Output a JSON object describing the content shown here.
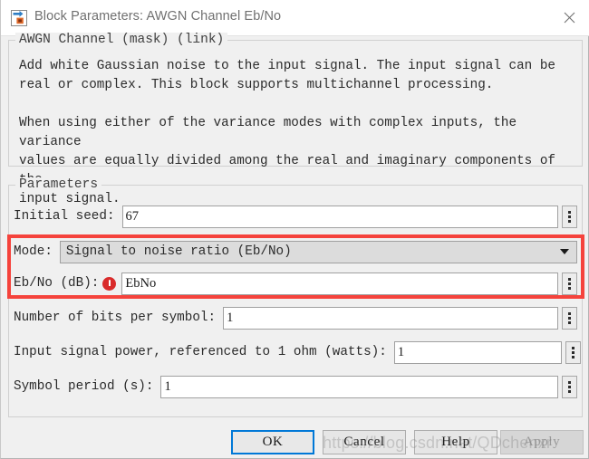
{
  "window": {
    "title": "Block Parameters: AWGN Channel Eb/No",
    "icon": "simulink-block-icon",
    "close_icon": "close-icon"
  },
  "description_group": {
    "legend": "AWGN Channel (mask) (link)",
    "paragraph1": "Add white Gaussian noise to the input signal. The input signal can be\nreal or complex. This block supports multichannel processing.",
    "paragraph2": "When using either of the variance modes with complex inputs, the variance\nvalues are equally divided among the real and imaginary components of the\ninput signal."
  },
  "parameters_group": {
    "legend": "Parameters",
    "rows": {
      "initial_seed": {
        "label": "Initial seed:",
        "value": "67",
        "spinner_icon": "vertical-ellipsis-icon"
      },
      "mode": {
        "label": "Mode:",
        "value": "Signal to noise ratio  (Eb/No)",
        "arrow_icon": "chevron-down-icon"
      },
      "ebno": {
        "label": "Eb/No (dB):",
        "value": "EbNo",
        "error_icon": "error-exclamation-icon",
        "spinner_icon": "vertical-ellipsis-icon"
      },
      "bits_per_symbol": {
        "label": "Number of bits per symbol:",
        "value": "1",
        "spinner_icon": "vertical-ellipsis-icon"
      },
      "input_signal_power": {
        "label": "Input signal power, referenced to 1 ohm (watts):",
        "value": "1",
        "spinner_icon": "vertical-ellipsis-icon"
      },
      "symbol_period": {
        "label": "Symbol period (s):",
        "value": "1",
        "spinner_icon": "vertical-ellipsis-icon"
      }
    }
  },
  "footer": {
    "ok_label": "OK",
    "cancel_label": "Cancel",
    "help_label": "Help",
    "apply_label": "Apply"
  },
  "overlay": {
    "watermark": "https://blog.csdn.net/QDchenxr"
  },
  "colors": {
    "highlight": "#f5433c",
    "error": "#d92b2b",
    "focus": "#0078d7",
    "background": "#f0f0f0"
  }
}
